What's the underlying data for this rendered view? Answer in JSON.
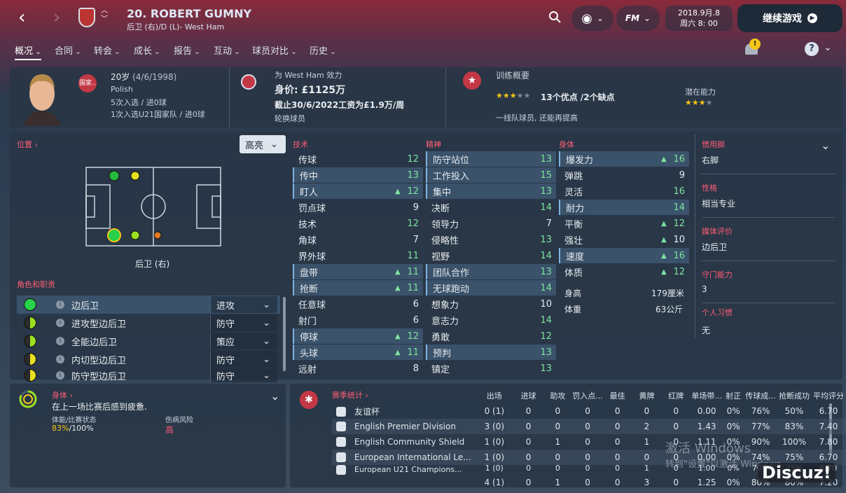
{
  "header": {
    "title": "20. ROBERT GUMNY",
    "subtitle": "后卫 (右)/D (L)- West Ham",
    "date": "2018.9月.8",
    "time": "周六 8: 00",
    "continue": "继续游戏",
    "fm": "FM"
  },
  "menu": [
    "概况",
    "合同",
    "转会",
    "成长",
    "报告",
    "互动",
    "球员对比",
    "历史"
  ],
  "notif_badge": "!",
  "help": "?",
  "profile": {
    "age": "20岁",
    "birth": "(4/6/1998)",
    "nation_badge": "国家..",
    "nationality": "Polish",
    "caps1": "5次入选 / 进0球",
    "caps2": "1次入选U21国家队 / 进0球",
    "club_line": "为 West Ham 效力",
    "value": "身价: £1125万",
    "contract": "截止30/6/2022工资为£1.9万/周",
    "squad": "轮换球员",
    "training_title": "训练概要",
    "stars_text": "13个优点 /2个缺点",
    "training_desc": "一线队球员, 还能再提高",
    "potential_title": "潜在能力"
  },
  "position": {
    "header": "位置 ›",
    "highlight": "高亮",
    "label": "后卫 (右)"
  },
  "roles_header": "角色和职责",
  "roles": [
    {
      "name": "边后卫",
      "duty": "进攻",
      "color": "#27d14a"
    },
    {
      "name": "进攻型边后卫",
      "duty": "防守",
      "color": "#9be020"
    },
    {
      "name": "全能边后卫",
      "duty": "策应",
      "color": "#9be020"
    },
    {
      "name": "内切型边后卫",
      "duty": "防守",
      "color": "#e6e020"
    },
    {
      "name": "防守型边后卫",
      "duty": "防守",
      "color": "#e6e020"
    }
  ],
  "attr_headers": {
    "tech": "技术",
    "mental": "精神",
    "phys": "身体"
  },
  "technical": [
    [
      "传球",
      "12",
      ""
    ],
    [
      "传中",
      "13",
      ""
    ],
    [
      "盯人",
      "12",
      "▲"
    ],
    [
      "罚点球",
      "9",
      ""
    ],
    [
      "技术",
      "12",
      ""
    ],
    [
      "角球",
      "7",
      ""
    ],
    [
      "界外球",
      "11",
      ""
    ],
    [
      "盘带",
      "11",
      "▲"
    ],
    [
      "抢断",
      "11",
      "▲"
    ],
    [
      "任意球",
      "6",
      ""
    ],
    [
      "射门",
      "6",
      ""
    ],
    [
      "停球",
      "12",
      "▲"
    ],
    [
      "头球",
      "11",
      "▲"
    ],
    [
      "远射",
      "8",
      ""
    ]
  ],
  "mental": [
    [
      "防守站位",
      "13",
      ""
    ],
    [
      "工作投入",
      "15",
      ""
    ],
    [
      "集中",
      "13",
      ""
    ],
    [
      "决断",
      "14",
      ""
    ],
    [
      "领导力",
      "7",
      ""
    ],
    [
      "侵略性",
      "13",
      ""
    ],
    [
      "视野",
      "14",
      ""
    ],
    [
      "团队合作",
      "13",
      ""
    ],
    [
      "无球跑动",
      "14",
      ""
    ],
    [
      "想象力",
      "10",
      ""
    ],
    [
      "意志力",
      "14",
      ""
    ],
    [
      "勇敢",
      "12",
      ""
    ],
    [
      "预判",
      "13",
      ""
    ],
    [
      "镇定",
      "13",
      ""
    ]
  ],
  "physical": [
    [
      "爆发力",
      "16",
      "▲"
    ],
    [
      "弹跳",
      "9",
      ""
    ],
    [
      "灵活",
      "16",
      ""
    ],
    [
      "耐力",
      "14",
      ""
    ],
    [
      "平衡",
      "12",
      "▲"
    ],
    [
      "强壮",
      "10",
      "▲"
    ],
    [
      "速度",
      "16",
      "▲"
    ],
    [
      "体质",
      "12",
      "▲"
    ]
  ],
  "body": {
    "height_label": "身高",
    "height": "179厘米",
    "weight_label": "体重",
    "weight": "63公斤"
  },
  "side": {
    "foot_label": "惯用脚",
    "foot": "右脚",
    "personality_label": "性格",
    "personality": "相当专业",
    "media_label": "媒体评价",
    "media": "边后卫",
    "gk_label": "守门能力",
    "gk": "3",
    "habit_label": "个人习惯",
    "habit": "无"
  },
  "fitness": {
    "header": "身体 ›",
    "status": "在上一场比赛后感到疲惫.",
    "cond_label": "体能/比赛状态",
    "cond_a": "83%",
    "cond_b": "/100%",
    "injury_label": "伤病风险",
    "injury": "高"
  },
  "stats": {
    "header": "赛季统计 ›",
    "columns": [
      "出场",
      "进球",
      "助攻",
      "罚入点...",
      "最佳",
      "黄牌",
      "红牌",
      "单场带...",
      "射正",
      "传球成...",
      "抢断成功",
      "平均评分"
    ],
    "rows": [
      [
        "友谊杯",
        "0 (1)",
        "0",
        "0",
        "0",
        "0",
        "0",
        "0",
        "0.00",
        "0%",
        "76%",
        "50%",
        "6.70"
      ],
      [
        "English Premier Division",
        "3 (0)",
        "0",
        "0",
        "0",
        "0",
        "2",
        "0",
        "1.43",
        "0%",
        "77%",
        "83%",
        "7.40"
      ],
      [
        "English Community Shield",
        "1 (0)",
        "0",
        "1",
        "0",
        "0",
        "1",
        "0",
        "1.11",
        "0%",
        "90%",
        "100%",
        "7.80"
      ],
      [
        "European International Le...",
        "1 (0)",
        "0",
        "0",
        "0",
        "0",
        "0",
        "0",
        "0.00",
        "0%",
        "74%",
        "75%",
        "6.70"
      ],
      [
        "European U21 Champions...",
        "1 (0)",
        "0",
        "0",
        "0",
        "0",
        "1",
        "0",
        "1.00",
        "0%",
        "70%",
        "75%",
        "6.70"
      ]
    ],
    "total": [
      "4 (1)",
      "0",
      "1",
      "0",
      "0",
      "3",
      "0",
      "1.25",
      "0%",
      "80%",
      "80%",
      "7.20"
    ]
  },
  "watermark": {
    "line1": "激活 Windows",
    "line2": "转到\"设置\"以激活 Windows。",
    "brand": "Discuz!"
  }
}
